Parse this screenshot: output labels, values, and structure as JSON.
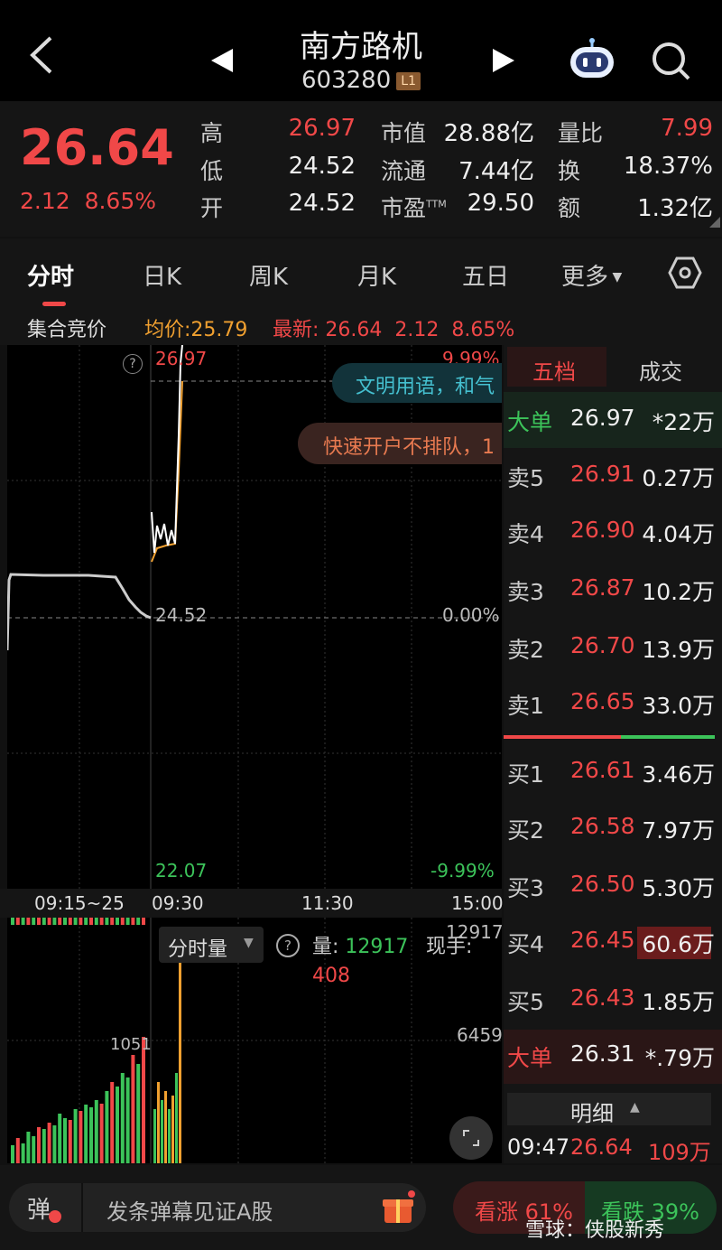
{
  "header": {
    "title": "南方路机",
    "code": "603280",
    "level": "L1"
  },
  "quote": {
    "price": "26.64",
    "change": "2.12",
    "change_pct": "8.65%",
    "rows": [
      {
        "l1": "高",
        "v1": "26.97",
        "l2": "市值",
        "v2": "28.88亿",
        "l3": "量比",
        "v3": "7.99"
      },
      {
        "l1": "低",
        "v1": "24.52",
        "l2": "流通",
        "v2": "7.44亿",
        "l3": "换",
        "v3": "18.37%"
      },
      {
        "l1": "开",
        "v1": "24.52",
        "l2": "市盈",
        "v2": "29.50",
        "l3": "额",
        "v3": "1.32亿"
      }
    ],
    "ttm": "TTM"
  },
  "tabs": [
    "分时",
    "日K",
    "周K",
    "月K",
    "五日",
    "更多"
  ],
  "infobar": {
    "auction": "集合竞价",
    "avg_label": "均价:",
    "avg": "25.79",
    "latest_label": "最新:",
    "latest": "26.64",
    "chg": "2.12",
    "pct": "8.65%"
  },
  "chart": {
    "high": "26.97",
    "high_pct": "9.99%",
    "base": "24.52",
    "base_pct": "0.00%",
    "low": "22.07",
    "low_pct": "-9.99%",
    "times": [
      "09:15~25",
      "09:30",
      "11:30",
      "15:00"
    ],
    "ticker1": "文明用语，和气",
    "ticker2": "快速开户不排队，1",
    "help": "?"
  },
  "vol": {
    "label": "分时量",
    "vol_label": "量:",
    "vol_val": "12917",
    "now_label": "现手:",
    "now_val": "408",
    "max": "12917",
    "mid": "6459",
    "left_mid": "1051"
  },
  "book": {
    "tabs": [
      "五档",
      "成交"
    ],
    "sell": [
      {
        "l": "大单",
        "p": "26.97",
        "v": "*22万"
      },
      {
        "l": "卖5",
        "p": "26.91",
        "v": "0.27万"
      },
      {
        "l": "卖4",
        "p": "26.90",
        "v": "4.04万"
      },
      {
        "l": "卖3",
        "p": "26.87",
        "v": "10.2万"
      },
      {
        "l": "卖2",
        "p": "26.70",
        "v": "13.9万"
      },
      {
        "l": "卖1",
        "p": "26.65",
        "v": "33.0万"
      }
    ],
    "buy": [
      {
        "l": "买1",
        "p": "26.61",
        "v": "3.46万"
      },
      {
        "l": "买2",
        "p": "26.58",
        "v": "7.97万"
      },
      {
        "l": "买3",
        "p": "26.50",
        "v": "5.30万"
      },
      {
        "l": "买4",
        "p": "26.45",
        "v": "60.6万"
      },
      {
        "l": "买5",
        "p": "26.43",
        "v": "1.85万"
      },
      {
        "l": "大单",
        "p": "26.31",
        "v": "*.79万"
      }
    ],
    "detail_label": "明细",
    "trade": {
      "time": "09:47",
      "price": "26.64",
      "vol": "109万"
    }
  },
  "footer": {
    "danmu_icon": "弹",
    "danmu_placeholder": "发条弹幕见证A股",
    "bullish": "看涨 61%",
    "bearish": "看跌 39%",
    "watermark": "雪球：侠股新秀"
  }
}
